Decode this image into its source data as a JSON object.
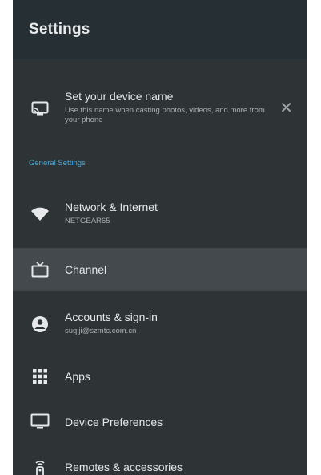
{
  "header": {
    "title": "Settings"
  },
  "device_name_card": {
    "title": "Set your device name",
    "description": "Use this name when casting photos, videos, and more from your phone",
    "dismiss_icon": "close-icon"
  },
  "section_label": "General Settings",
  "items": [
    {
      "label": "Network & Internet",
      "subtitle": "NETGEAR65",
      "icon": "wifi-icon"
    },
    {
      "label": "Channel",
      "subtitle": "",
      "icon": "tv-icon"
    },
    {
      "label": "Accounts & sign-in",
      "subtitle": "suqiji@szmtc.com.cn",
      "icon": "account-icon"
    },
    {
      "label": "Apps",
      "subtitle": "",
      "icon": "apps-grid-icon"
    },
    {
      "label": "Device Preferences",
      "subtitle": "",
      "icon": "monitor-icon"
    },
    {
      "label": "Remotes & accessories",
      "subtitle": "",
      "icon": "remote-icon"
    }
  ],
  "colors": {
    "panel": "#2e3436",
    "header": "#263034",
    "accent": "#4aa8d8",
    "selected": "#43494c"
  }
}
